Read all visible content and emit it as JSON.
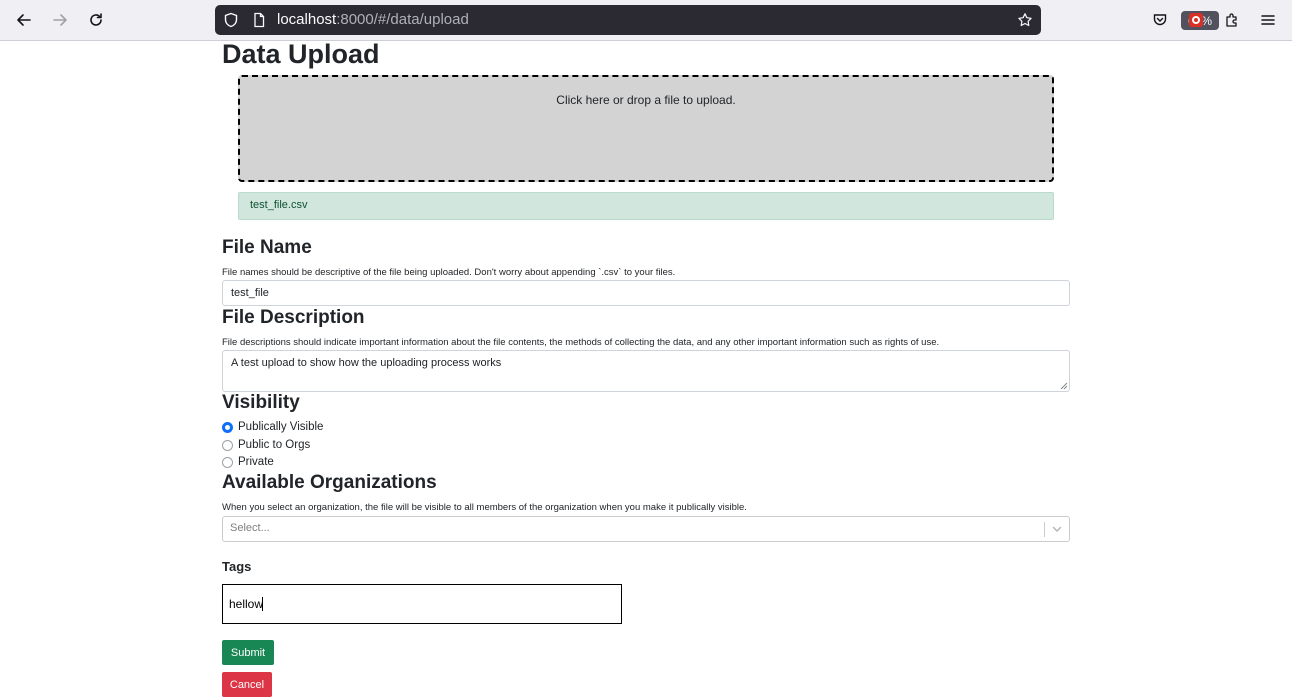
{
  "browser": {
    "url_host": "localhost",
    "url_rest": ":8000/#/data/upload",
    "zoom": "67%"
  },
  "page": {
    "title": "Data Upload",
    "dropzone_text": "Click here or drop a file to upload.",
    "selected_file": "test_file.csv",
    "file_name": {
      "heading": "File Name",
      "help": "File names should be descriptive of the file being uploaded. Don't worry about appending `.csv` to your files.",
      "value": "test_file"
    },
    "file_description": {
      "heading": "File Description",
      "help": "File descriptions should indicate important information about the file contents, the methods of collecting the data, and any other important information such as rights of use.",
      "value": "A test upload to show how the uploading process works"
    },
    "visibility": {
      "heading": "Visibility",
      "options": [
        "Publically Visible",
        "Public to Orgs",
        "Private"
      ],
      "selected": "Publically Visible"
    },
    "organizations": {
      "heading": "Available Organizations",
      "help": "When you select an organization, the file will be visible to all members of the organization when you make it publically visible.",
      "placeholder": "Select..."
    },
    "tags": {
      "label": "Tags",
      "value": "hellow"
    },
    "submit_label": "Submit",
    "cancel_label": "Cancel"
  }
}
